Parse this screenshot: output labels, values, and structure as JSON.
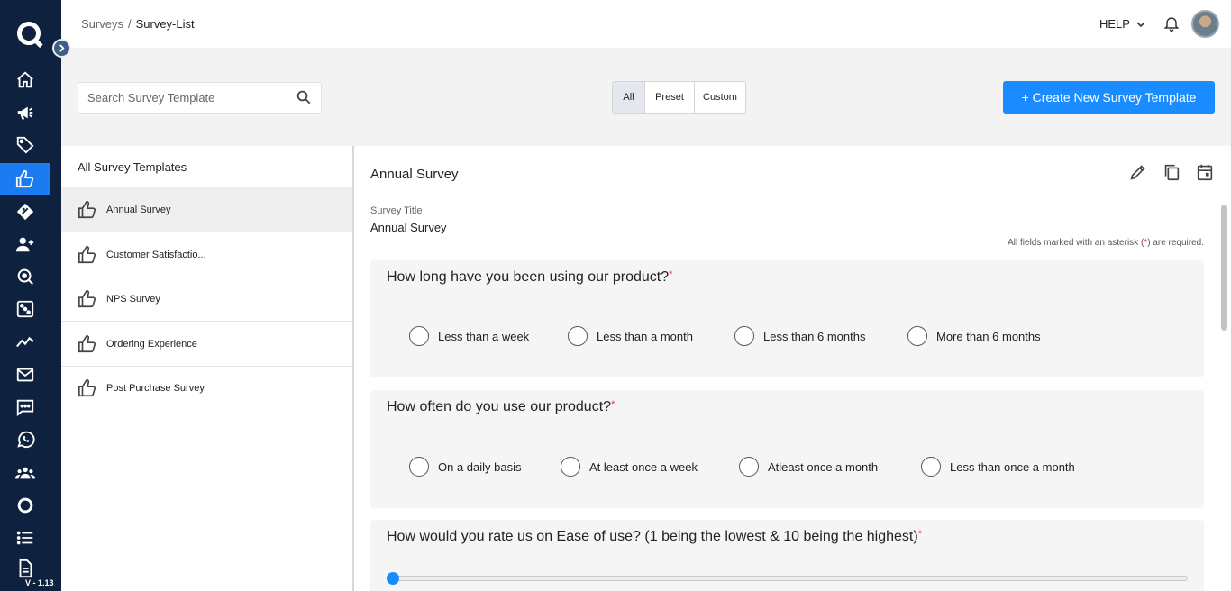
{
  "nav": {
    "items": [
      {
        "name": "home-icon"
      },
      {
        "name": "megaphone-icon"
      },
      {
        "name": "tag-icon"
      },
      {
        "name": "thumbs-up-icon"
      },
      {
        "name": "offer-icon"
      },
      {
        "name": "add-user-icon"
      },
      {
        "name": "location-search-icon"
      },
      {
        "name": "dice-icon"
      },
      {
        "name": "analytics-icon"
      },
      {
        "name": "mail-icon"
      },
      {
        "name": "chat-icon"
      },
      {
        "name": "whatsapp-icon"
      },
      {
        "name": "group-icon"
      },
      {
        "name": "ring-icon"
      },
      {
        "name": "list-icon"
      },
      {
        "name": "document-icon"
      }
    ],
    "version": "V - 1.13",
    "accent": "#1a7cf0",
    "background": "#0e2240"
  },
  "header": {
    "breadcrumb_root": "Surveys",
    "breadcrumb_sep": "/",
    "breadcrumb_current": "Survey-List",
    "help_label": "HELP"
  },
  "toolbar": {
    "search_placeholder": "Search Survey Template",
    "filters": [
      "All",
      "Preset",
      "Custom"
    ],
    "active_filter": "All",
    "create_label": "+ Create New Survey Template"
  },
  "list": {
    "header": "All Survey Templates",
    "items": [
      "Annual Survey",
      "Customer Satisfactio...",
      "NPS Survey",
      "Ordering Experience",
      "Post Purchase Survey"
    ],
    "selected": "Annual Survey"
  },
  "detail": {
    "title": "Annual Survey",
    "field_label": "Survey Title",
    "field_value": "Annual Survey",
    "req_note_pre": "All fields marked with an asterisk (",
    "req_note_star": "*",
    "req_note_post": ") are required.",
    "questions": [
      {
        "title": "How long have you been using our product?",
        "options": [
          "Less than a week",
          "Less than a month",
          "Less than 6 months",
          "More than 6 months"
        ]
      },
      {
        "title": "How often do you use our product?",
        "options": [
          "On a daily basis",
          "At least once a week",
          "Atleast once a month",
          "Less than once a month"
        ]
      },
      {
        "title": "How would you rate us on Ease of use? (1 being the lowest & 10 being the highest)",
        "slider_value": 1
      }
    ],
    "asterisk": "*"
  }
}
